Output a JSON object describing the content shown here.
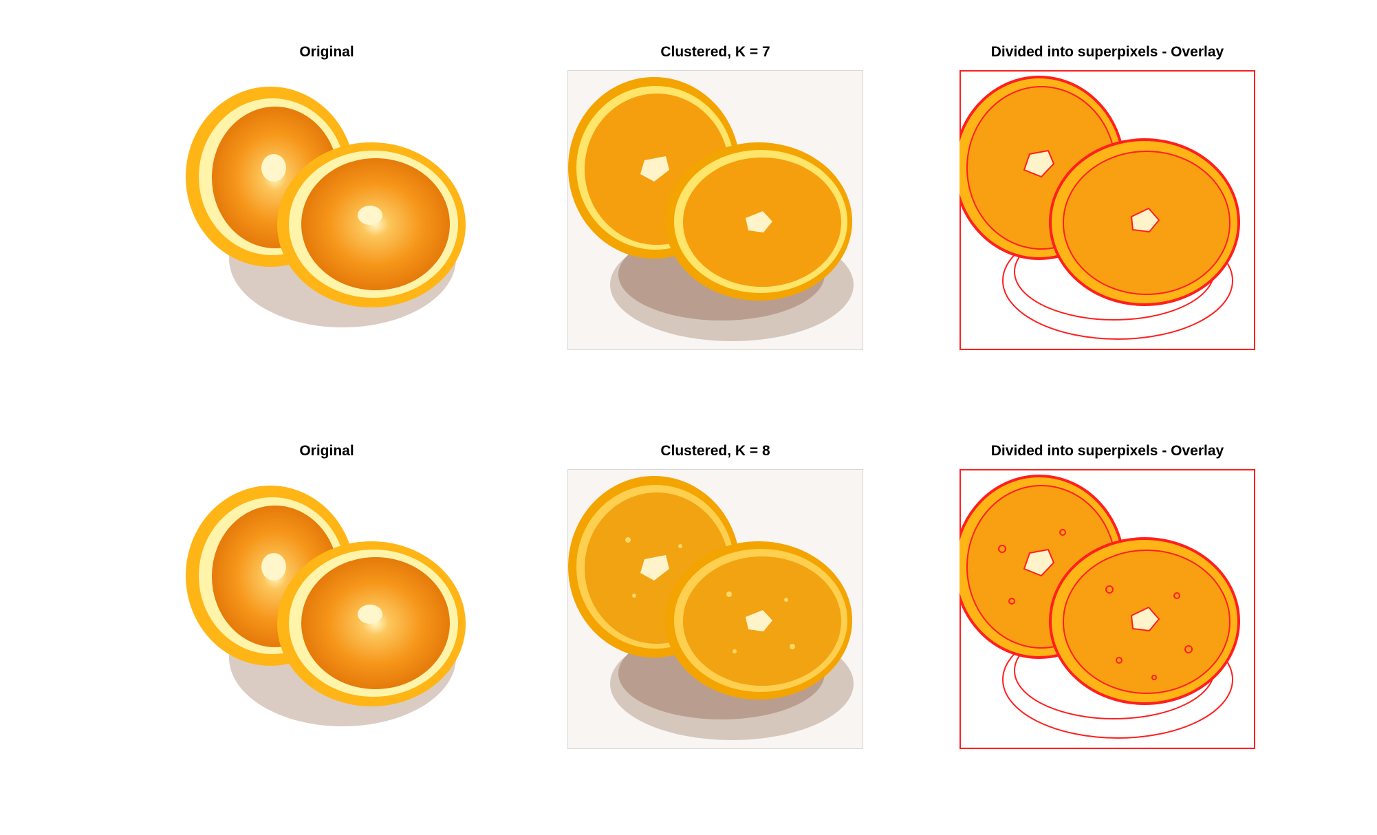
{
  "panels": [
    {
      "title": "Original",
      "kind": "original"
    },
    {
      "title": "Clustered, K = 7",
      "kind": "clustered-7"
    },
    {
      "title": "Divided into superpixels - Overlay",
      "kind": "overlay-7"
    },
    {
      "title": "Original",
      "kind": "original"
    },
    {
      "title": "Clustered, K = 8",
      "kind": "clustered-8"
    },
    {
      "title": "Divided into superpixels - Overlay",
      "kind": "overlay-8"
    }
  ],
  "colors": {
    "rind": "#ffae10",
    "pith": "#ffe56a",
    "flesh": "#f89f12",
    "flesh_dark": "#ec8d0a",
    "center": "#fff4c9",
    "shadow": "#b9a08e",
    "shadow_light": "#d7c7bd",
    "background_clustered": "#f8f5f3",
    "boundary": "#ff1f1f"
  }
}
